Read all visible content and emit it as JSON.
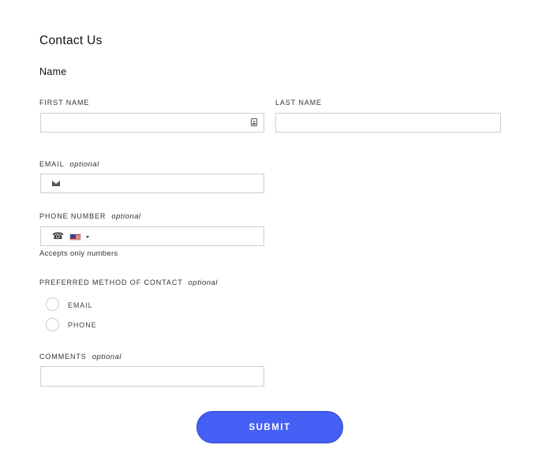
{
  "form": {
    "title": "Contact Us",
    "name_section": "Name",
    "first_name_label": "FIRST NAME",
    "last_name_label": "LAST NAME",
    "email_label": "EMAIL",
    "phone_label": "PHONE NUMBER",
    "optional_text": "optional",
    "phone_hint": "Accepts only numbers",
    "contact_method_label": "PREFERRED METHOD OF CONTACT",
    "contact_options": [
      "EMAIL",
      "PHONE"
    ],
    "comments_label": "COMMENTS",
    "submit_label": "SUBMIT"
  },
  "icons": {
    "first_name_field": "contact-card-icon",
    "email_field": "envelope-icon",
    "phone_field": "phone-icon",
    "country": "us-flag-icon",
    "country_dropdown": "caret-down-icon"
  },
  "colors": {
    "submit_bg": "#4560f5",
    "field_border": "#cfcfcf"
  }
}
